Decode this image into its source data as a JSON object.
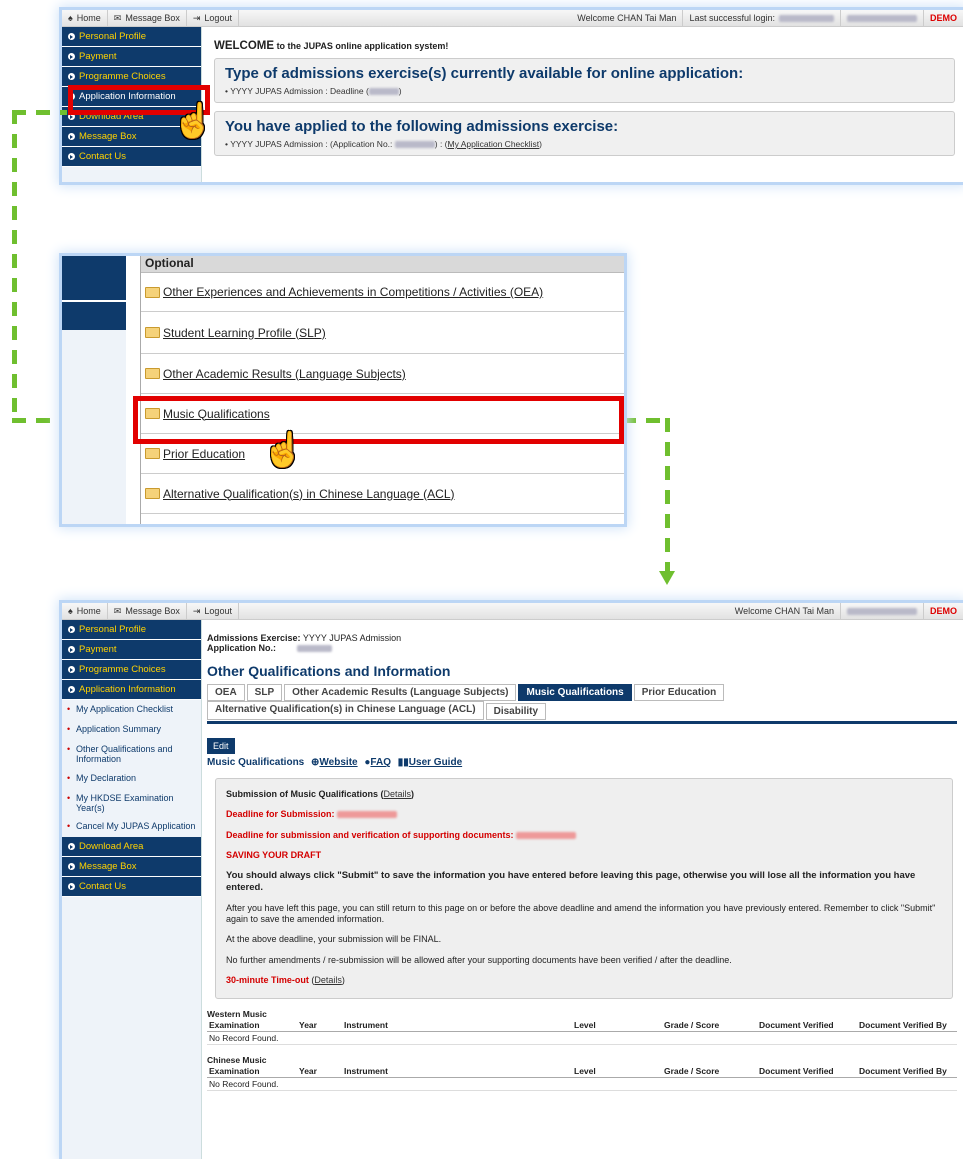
{
  "topbar": {
    "home": "Home",
    "message_box": "Message Box",
    "logout": "Logout",
    "welcome": "Welcome CHAN Tai Man",
    "last_login": "Last successful login:",
    "demo": "DEMO"
  },
  "panel1": {
    "sidebar": [
      "Personal Profile",
      "Payment",
      "Programme Choices",
      "Application Information",
      "Download Area",
      "Message Box",
      "Contact Us"
    ],
    "welcome_bold": "WELCOME",
    "welcome_rest": " to the JUPAS online application system!",
    "type_heading": "Type of admissions exercise(s) currently available for online application:",
    "type_bullet": "YYYY JUPAS Admission :  Deadline (",
    "applied_heading": "You have applied to the following admissions exercise:",
    "applied_bullet": "YYYY JUPAS Admission :  (Application No.:",
    "applied_link": "My Application Checklist"
  },
  "panel2": {
    "header": "Optional",
    "rows": [
      "Other Experiences and Achievements in Competitions / Activities (OEA)",
      "Student Learning Profile (SLP)",
      "Other Academic Results (Language Subjects)",
      "Music Qualifications",
      "Prior Education",
      "Alternative Qualification(s) in Chinese Language (ACL)"
    ]
  },
  "panel3": {
    "sidebar_top": [
      "Personal Profile",
      "Payment",
      "Programme Choices",
      "Application Information"
    ],
    "sidebar_sub": [
      "My Application Checklist",
      "Application Summary",
      "Other Qualifications and Information",
      "My Declaration",
      "My HKDSE Examination Year(s)",
      "Cancel My JUPAS Application"
    ],
    "sidebar_bottom": [
      "Download Area",
      "Message Box",
      "Contact Us"
    ],
    "exercise_label": "Admissions Exercise:",
    "exercise_value": "YYYY JUPAS Admission",
    "appno_label": "Application No.:",
    "title": "Other Qualifications and Information",
    "tabs": [
      "OEA",
      "SLP",
      "Other Academic Results (Language Subjects)",
      "Music Qualifications",
      "Prior Education",
      "Alternative Qualification(s) in Chinese Language (ACL)",
      "Disability"
    ],
    "edit": "Edit",
    "section_title": "Music Qualifications",
    "website": "Website",
    "faq": "FAQ",
    "guide": "User Guide",
    "sub_title": "Submission of Music Qualifications",
    "details": "Details",
    "deadline1": "Deadline for Submission:",
    "deadline2": "Deadline for submission and verification of supporting documents:",
    "saving": "SAVING YOUR DRAFT",
    "warn": "You should always click \"Submit\" to save the information you have entered before leaving this page, otherwise you will lose all the information you have entered.",
    "p1": "After you have left this page, you can still return to this page on or before the above deadline and amend the information you have previously entered. Remember to click \"Submit\" again to save the amended information.",
    "p2": "At the above deadline, your submission will be FINAL.",
    "p3": "No further amendments / re-submission will be allowed after your supporting documents have been verified / after the deadline.",
    "timeout": "30-minute Time-out",
    "western": "Western Music",
    "chinese": "Chinese Music",
    "cols": [
      "Examination",
      "Year",
      "Instrument",
      "Level",
      "Grade / Score",
      "Document Verified",
      "Document Verified By"
    ],
    "norecord": "No Record Found."
  }
}
